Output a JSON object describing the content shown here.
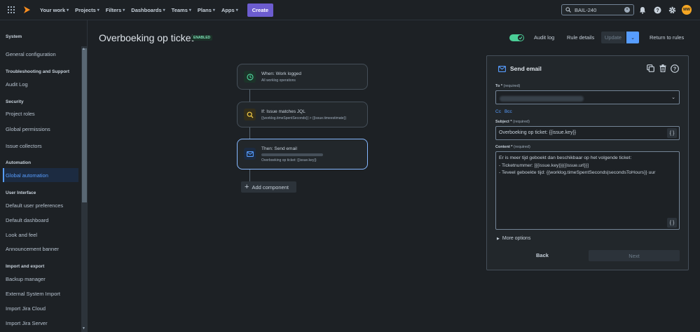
{
  "topnav": {
    "items": [
      "Your work",
      "Projects",
      "Filters",
      "Dashboards",
      "Teams",
      "Plans",
      "Apps"
    ],
    "create_label": "Create",
    "search_value": "BAIL-240",
    "avatar_initials": "MW"
  },
  "sidebar": {
    "groups": [
      {
        "heading": "System",
        "items": [
          "General configuration"
        ]
      },
      {
        "heading": "Troubleshooting and Support",
        "items": [
          "Audit Log"
        ]
      },
      {
        "heading": "Security",
        "items": [
          "Project roles",
          "Global permissions",
          "Issue collectors"
        ]
      },
      {
        "heading": "Automation",
        "items": [
          "Global automation"
        ]
      },
      {
        "heading": "User Interface",
        "items": [
          "Default user preferences",
          "Default dashboard",
          "Look and feel",
          "Announcement banner"
        ]
      },
      {
        "heading": "Import and export",
        "items": [
          "Backup manager",
          "External System Import",
          "Import Jira Cloud",
          "Import Jira Server"
        ]
      }
    ],
    "active_item": "Global automation"
  },
  "header": {
    "title": "Overboeking op ticket",
    "status": "ENABLED",
    "audit_log": "Audit log",
    "rule_details": "Rule details",
    "update": "Update",
    "return": "Return to rules"
  },
  "flow": {
    "trigger": {
      "title": "When: Work logged",
      "subtitle": "All worklog operations"
    },
    "condition": {
      "title": "If: Issue matches JQL",
      "subtitle": "{{worklog.timeSpentSeconds}} > {{issue.timeestimate}}"
    },
    "action": {
      "title": "Then: Send email",
      "subtitle": "Overboeking op ticket: {{issue.key}}"
    },
    "add_component": "Add component"
  },
  "panel": {
    "title": "Send email",
    "to_label": "To *",
    "to_req": "(required)",
    "cc": "Cc",
    "bcc": "Bcc",
    "subject_label": "Subject *",
    "subject_req": "(required)",
    "subject_value": "Overboeking op ticket: {{issue.key}}",
    "content_label": "Content *",
    "content_req": "(required)",
    "content_lines": [
      "Er is meer tijd geboekt dan beschikbaar op het volgende ticket:",
      "- Ticketnummer: [{{issue.key}}|{{issue.url}}]",
      "- Teveel geboekte tijd: {{worklog.timeSpentSeconds|secondsToHours}} uur"
    ],
    "brace_label": "{ }",
    "more_options": "More options",
    "back": "Back",
    "next": "Next"
  },
  "colors": {
    "background": "#1d2125",
    "accent": "#579dff",
    "create": "#6c5ccf",
    "enabled": "#4bce97"
  }
}
